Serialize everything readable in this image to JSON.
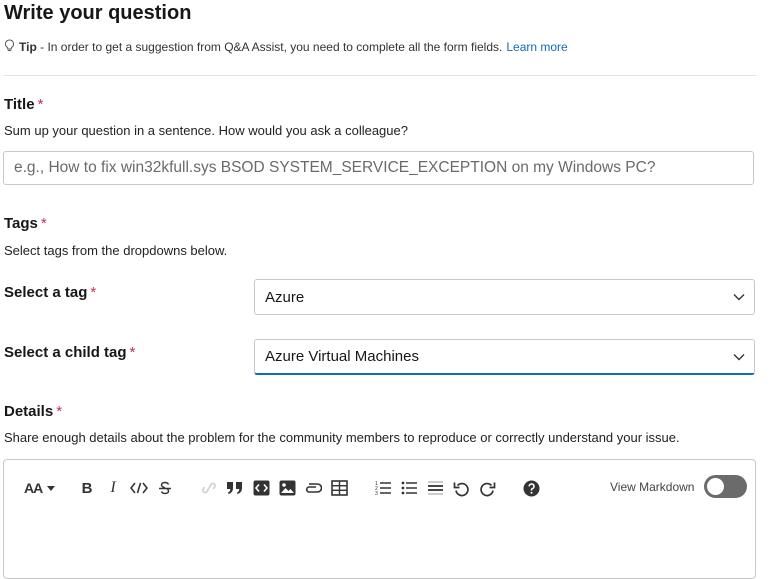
{
  "heading": "Write your question",
  "tip": {
    "label": "Tip",
    "text": " - In order to get a suggestion from Q&A Assist, you need to complete all the form fields.",
    "link": "Learn more"
  },
  "title_section": {
    "label": "Title",
    "required": "*",
    "description": "Sum up your question in a sentence. How would you ask a colleague?",
    "placeholder": "e.g., How to fix win32kfull.sys BSOD SYSTEM_SERVICE_EXCEPTION on my Windows PC?",
    "value": ""
  },
  "tags_section": {
    "label": "Tags",
    "required": "*",
    "description": "Select tags from the dropdowns below.",
    "tag": {
      "label": "Select a tag",
      "required": "*",
      "value": "Azure"
    },
    "child_tag": {
      "label": "Select a child tag",
      "required": "*",
      "value": "Azure Virtual Machines"
    }
  },
  "details_section": {
    "label": "Details",
    "required": "*",
    "description": "Share enough details about the problem for the community members to reproduce or correctly understand your issue."
  },
  "editor": {
    "font_size_label": "AA",
    "bold": "B",
    "italic": "I",
    "view_markdown": "View Markdown",
    "view_markdown_on": false,
    "tools": [
      "font-size-icon",
      "bold-icon",
      "italic-icon",
      "code-icon",
      "strikethrough-icon",
      "link-icon",
      "quote-icon",
      "code-block-icon",
      "image-icon",
      "attachment-icon",
      "table-icon",
      "numbered-list-icon",
      "bulleted-list-icon",
      "horizontal-rule-icon",
      "undo-icon",
      "redo-icon",
      "help-icon"
    ]
  },
  "colors": {
    "accent": "#0f6cbd",
    "required": "#c4314b",
    "border": "#c8c8c8",
    "toggle_off": "#6b6b6b"
  }
}
